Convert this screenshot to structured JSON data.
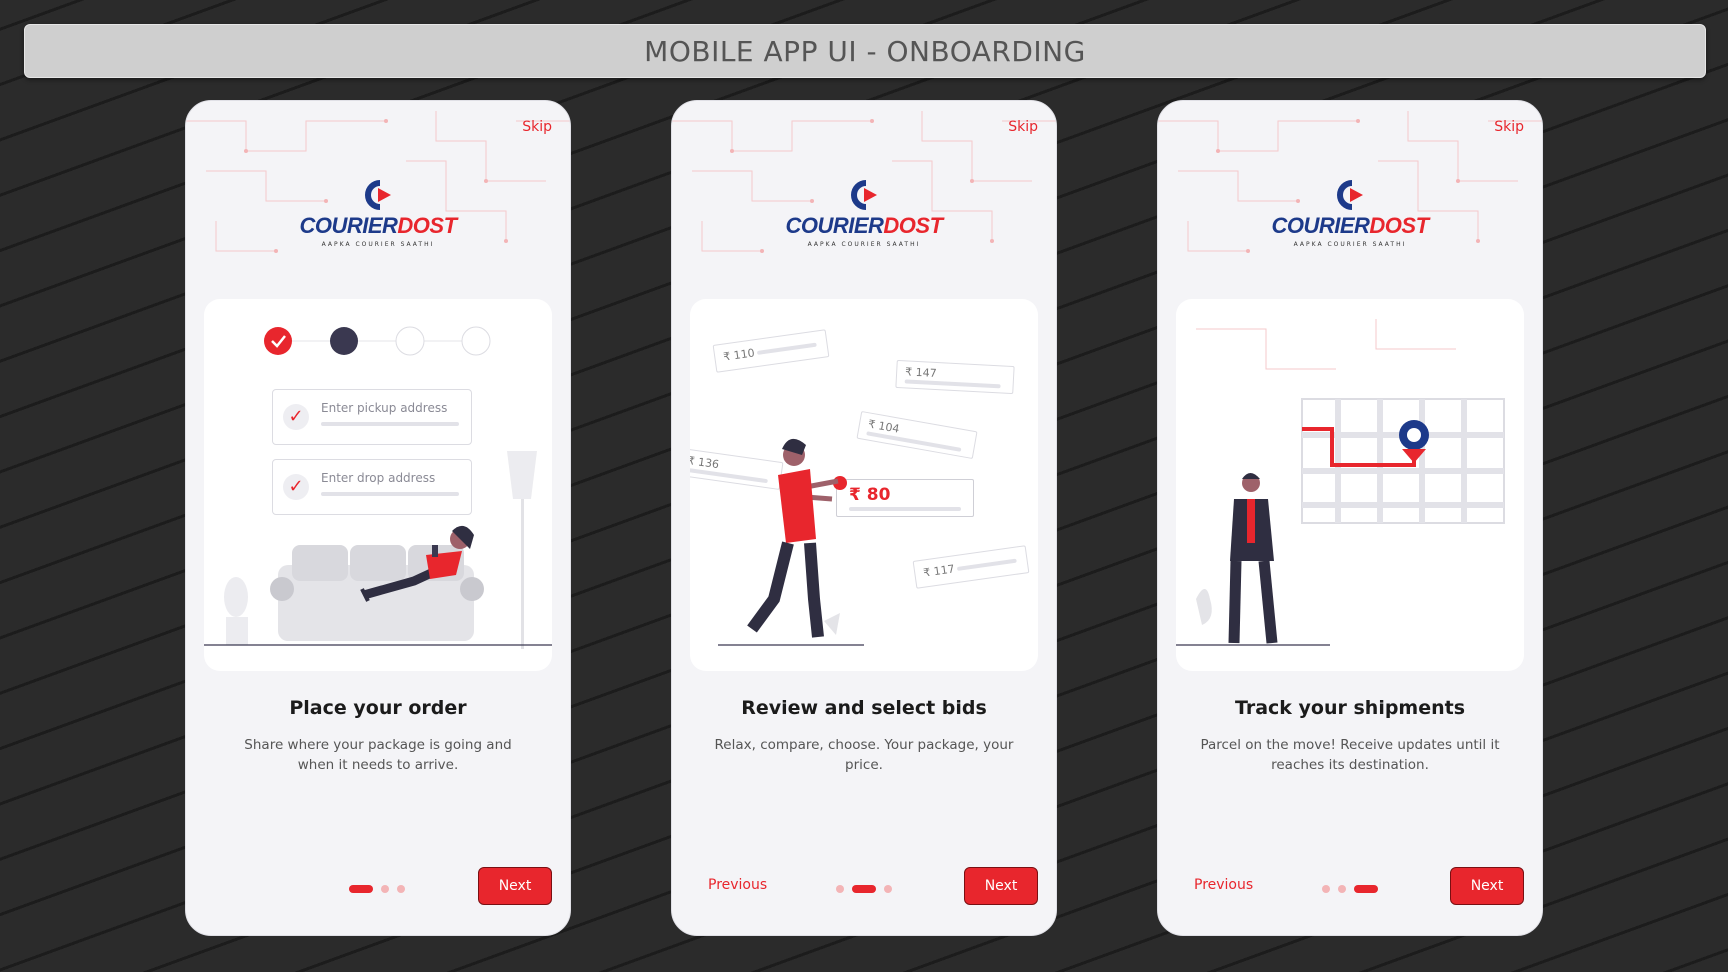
{
  "page_title": "MOBILE APP UI - ONBOARDING",
  "colors": {
    "accent": "#e8262d",
    "brand_blue": "#1d3a8a",
    "dark": "#3a3850"
  },
  "brand": {
    "word1": "COURIER",
    "word2": "DOST",
    "tagline": "AAPKA COURIER SAATHI"
  },
  "screens": [
    {
      "skip": "Skip",
      "heading": "Place your order",
      "description": "Share where your package is going and when it needs to arrive.",
      "pickup_placeholder": "Enter pickup address",
      "drop_placeholder": "Enter drop address",
      "next": "Next",
      "active_page": 1,
      "page_count": 3
    },
    {
      "skip": "Skip",
      "heading": "Review and select bids",
      "description": "Relax, compare, choose. Your package, your price.",
      "bids": [
        "₹ 110",
        "₹ 147",
        "₹ 104",
        "₹ 136",
        "₹ 117"
      ],
      "selected_bid": "₹ 80",
      "previous": "Previous",
      "next": "Next",
      "active_page": 2,
      "page_count": 3
    },
    {
      "skip": "Skip",
      "heading": "Track your shipments",
      "description": "Parcel on the move! Receive updates until it reaches its destination.",
      "previous": "Previous",
      "next": "Next",
      "active_page": 3,
      "page_count": 3
    }
  ]
}
